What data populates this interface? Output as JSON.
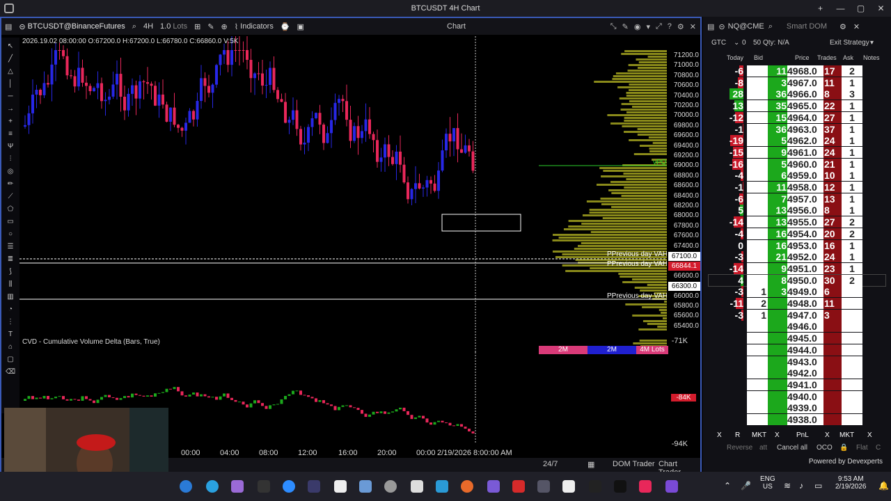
{
  "window": {
    "title": "BTCUSDT 4H Chart",
    "controls": [
      "+",
      "—",
      "▢",
      "✕"
    ]
  },
  "chart_toolbar": {
    "symbol": "BTCUSDT@BinanceFutures",
    "timeframe": "4H",
    "lots": "1.0",
    "lots_unit": "Lots",
    "indicators_label": "Indicators",
    "center_label": "Chart"
  },
  "ohlc_text": "2026.19.02 08:00:00 O:67200.0 H:67200.0 L:66780.0 C:66860.0 V:5K",
  "price_axis": {
    "ticks": [
      "71200.0",
      "71000.0",
      "70800.0",
      "70600.0",
      "70400.0",
      "70200.0",
      "70000.0",
      "69800.0",
      "69600.0",
      "69400.0",
      "69200.0",
      "69000.0",
      "68800.0",
      "68600.0",
      "68400.0",
      "68200.0",
      "68000.0",
      "67800.0",
      "67600.0",
      "67400.0",
      "67100.0",
      "66844.1",
      "66600.0",
      "66300.0",
      "66000.0",
      "65800.0",
      "65600.0",
      "65400.0"
    ],
    "current_price": "66844.1",
    "marker_price_1": "67100.0",
    "marker_price_2": "66300.0"
  },
  "annotations": {
    "vah_1": "PPrevious day VAH",
    "vah_2": "PPrevious day VAH",
    "vah_3": "PPrevious day VAH",
    "vpoc": "vPOC"
  },
  "volume_legend": [
    "2M",
    "2M",
    "4M Lots"
  ],
  "cvd": {
    "label": "CVD - Cumulative Volume Delta (Bars, True)",
    "ticks": [
      "-71K",
      "-84K",
      "-94K"
    ],
    "current": "-84K"
  },
  "time_axis": [
    "00:00",
    "04:00",
    "08:00",
    "12:00",
    "16:00",
    "20:00",
    "00:00",
    "2/19/2026 8:00:00 AM"
  ],
  "bottom_bar": {
    "session": "24/7",
    "dom_trader": "DOM Trader",
    "chart_trader": "Chart Trader"
  },
  "dom": {
    "symbol": "NQ@CME",
    "title": "Smart DOM",
    "tif": "GTC",
    "qty": "0",
    "qty2": "50",
    "qty_label": "Qty: N/A",
    "exit_strategy": "Exit Strategy",
    "headers": [
      "Today",
      "Bid",
      "Price",
      "Trades",
      "Ask",
      "Notes"
    ],
    "rows": [
      {
        "today": "-6",
        "bid": "",
        "bidbar": "11",
        "price": "4968.0",
        "trades": "17",
        "ask": "2"
      },
      {
        "today": "-8",
        "bid": "",
        "bidbar": "3",
        "price": "4967.0",
        "trades": "11",
        "ask": "1"
      },
      {
        "today": "28",
        "bid": "",
        "bidbar": "36",
        "price": "4966.0",
        "trades": "8",
        "ask": "3"
      },
      {
        "today": "13",
        "bid": "",
        "bidbar": "35",
        "price": "4965.0",
        "trades": "22",
        "ask": "1"
      },
      {
        "today": "-12",
        "bid": "",
        "bidbar": "15",
        "price": "4964.0",
        "trades": "27",
        "ask": "1"
      },
      {
        "today": "-1",
        "bid": "",
        "bidbar": "36",
        "price": "4963.0",
        "trades": "37",
        "ask": "1"
      },
      {
        "today": "-19",
        "bid": "",
        "bidbar": "5",
        "price": "4962.0",
        "trades": "24",
        "ask": "1"
      },
      {
        "today": "-15",
        "bid": "",
        "bidbar": "9",
        "price": "4961.0",
        "trades": "24",
        "ask": "1"
      },
      {
        "today": "-16",
        "bid": "",
        "bidbar": "5",
        "price": "4960.0",
        "trades": "21",
        "ask": "1"
      },
      {
        "today": "-4",
        "bid": "",
        "bidbar": "6",
        "price": "4959.0",
        "trades": "10",
        "ask": "1"
      },
      {
        "today": "-1",
        "bid": "",
        "bidbar": "11",
        "price": "4958.0",
        "trades": "12",
        "ask": "1"
      },
      {
        "today": "-6",
        "bid": "",
        "bidbar": "7",
        "price": "4957.0",
        "trades": "13",
        "ask": "1"
      },
      {
        "today": "5",
        "bid": "",
        "bidbar": "13",
        "price": "4956.0",
        "trades": "8",
        "ask": "1"
      },
      {
        "today": "-14",
        "bid": "",
        "bidbar": "13",
        "price": "4955.0",
        "trades": "27",
        "ask": "2"
      },
      {
        "today": "-4",
        "bid": "",
        "bidbar": "16",
        "price": "4954.0",
        "trades": "20",
        "ask": "2"
      },
      {
        "today": "0",
        "bid": "",
        "bidbar": "16",
        "price": "4953.0",
        "trades": "16",
        "ask": "1"
      },
      {
        "today": "-3",
        "bid": "",
        "bidbar": "21",
        "price": "4952.0",
        "trades": "24",
        "ask": "1"
      },
      {
        "today": "-14",
        "bid": "",
        "bidbar": "9",
        "price": "4951.0",
        "trades": "23",
        "ask": "1"
      },
      {
        "today": "4",
        "bid": "",
        "bidbar": "8",
        "price": "4950.0",
        "trades": "30",
        "ask": "2"
      },
      {
        "today": "-3",
        "bid": "1",
        "bidbar": "3",
        "price": "4949.0",
        "trades": "6",
        "ask": ""
      },
      {
        "today": "-11",
        "bid": "2",
        "bidbar": "",
        "price": "4948.0",
        "trades": "11",
        "ask": ""
      },
      {
        "today": "-3",
        "bid": "1",
        "bidbar": "",
        "price": "4947.0",
        "trades": "3",
        "ask": ""
      },
      {
        "today": "",
        "bid": "",
        "bidbar": "",
        "price": "4946.0",
        "trades": "",
        "ask": ""
      },
      {
        "today": "",
        "bid": "",
        "bidbar": "",
        "price": "4945.0",
        "trades": "",
        "ask": ""
      },
      {
        "today": "",
        "bid": "",
        "bidbar": "",
        "price": "4944.0",
        "trades": "",
        "ask": ""
      },
      {
        "today": "",
        "bid": "",
        "bidbar": "",
        "price": "4943.0",
        "trades": "",
        "ask": ""
      },
      {
        "today": "",
        "bid": "",
        "bidbar": "",
        "price": "4942.0",
        "trades": "",
        "ask": ""
      },
      {
        "today": "",
        "bid": "",
        "bidbar": "",
        "price": "4941.0",
        "trades": "",
        "ask": ""
      },
      {
        "today": "",
        "bid": "",
        "bidbar": "",
        "price": "4940.0",
        "trades": "",
        "ask": ""
      },
      {
        "today": "",
        "bid": "",
        "bidbar": "",
        "price": "4939.0",
        "trades": "",
        "ask": ""
      },
      {
        "today": "",
        "bid": "",
        "bidbar": "",
        "price": "4938.0",
        "trades": "",
        "ask": ""
      }
    ],
    "footer_x": [
      "X",
      "R",
      "MKT",
      "X",
      "PnL",
      "X",
      "MKT",
      "X"
    ],
    "reverse": "Reverse",
    "att": "att",
    "cancel_all": "Cancel all",
    "oco": "OCO",
    "flat": "Flat",
    "c": "C",
    "powered": "Powered by Devexperts"
  },
  "taskbar": {
    "lang1": "ENG",
    "lang2": "US",
    "time": "9:53 AM",
    "date": "2/19/2026"
  },
  "colors": {
    "bull": "#2727e6",
    "bear": "#e8275a",
    "profile": "#8a8a1a",
    "dom_green": "#1ca81c",
    "dom_red": "#8a0f14"
  }
}
